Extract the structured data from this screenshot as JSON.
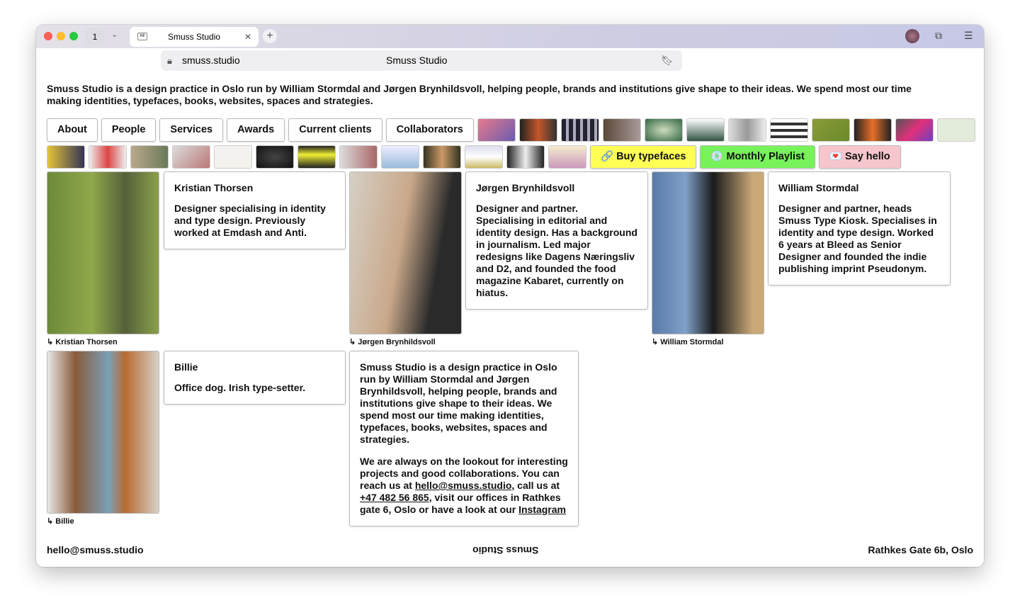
{
  "browser": {
    "tab_count": "1",
    "tab_title": "Smuss Studio",
    "favicon": "Hi!",
    "url": "smuss.studio",
    "page_title": "Smuss Studio"
  },
  "intro": "Smuss Studio is a design practice in Oslo run by William Stormdal and Jørgen Brynhildsvoll, helping people, brands and institutions give shape to their ideas. We spend most our time making identities, typefaces, books, websites, spaces and strategies.",
  "nav": [
    "About",
    "People",
    "Services",
    "Awards",
    "Current clients",
    "Collaborators"
  ],
  "links": {
    "buy": "🔗 Buy typefaces",
    "playlist": "💿 Monthly Playlist",
    "hello": "💌 Say hello"
  },
  "colors": {
    "buy": "#ffff55",
    "playlist": "#77f25a",
    "hello": "#f6c6cc"
  },
  "people": [
    {
      "name": "Kristian Thorsen",
      "bio": "Designer specialising in identity and type design. Previously worked at Emdash and Anti.",
      "caption": "↳ Kristian Thorsen"
    },
    {
      "name": "Jørgen Brynhildsvoll",
      "bio": "Designer and partner. Specialising in editorial and identity design. Has a background in journalism. Led major redesigns like Dagens Næringsliv and D2, and founded the food magazine Kabaret, currently on hiatus.",
      "caption": "↳ Jørgen Brynhildsvoll"
    },
    {
      "name": "William Stormdal",
      "bio": "Designer and partner, heads Smuss Type Kiosk. Specialises in identity and type design. Worked 6 years at Bleed as Senior Designer and founded the indie publishing imprint Pseudonym.",
      "caption": "↳ William Stormdal"
    },
    {
      "name": "Billie",
      "bio": "Office dog. Irish type-setter.",
      "caption": "↳ Billie"
    }
  ],
  "about": {
    "p1": "Smuss Studio is a design practice in Oslo run by William Stormdal and Jørgen Brynhildsvoll, helping people, brands and institutions give shape to their ideas. We spend most our time making identities, typefaces, books, websites, spaces and strategies.",
    "p2a": "We are always on the lookout for interesting projects and good collaborations. You can reach us at ",
    "email": "hello@smuss.studio",
    "p2b": ", call us at ",
    "phone": "+47 482 56 865",
    "p2c": ", visit our offices in Rathkes gate 6, Oslo or have a look at our ",
    "instagram": "Instagram"
  },
  "footer": {
    "email": "hello@smuss.studio",
    "logo": "Smuss Studio",
    "address": "Rathkes Gate 6b, Oslo"
  }
}
